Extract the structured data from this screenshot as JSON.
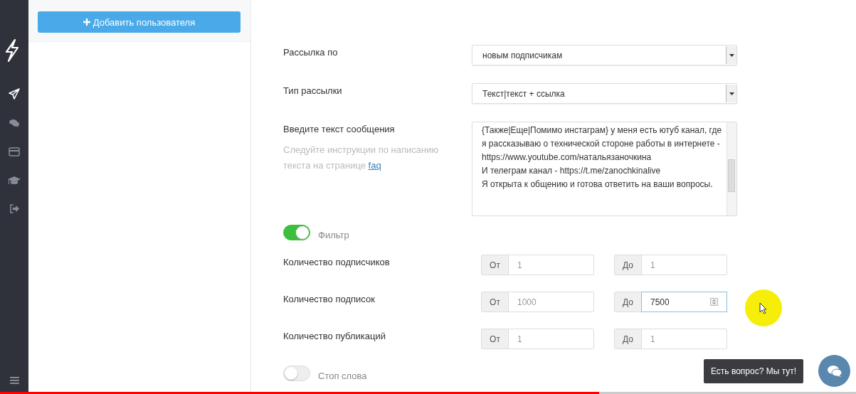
{
  "side_panel": {
    "add_button": "Добавить пользователя"
  },
  "form": {
    "selects": [
      {
        "label": "Рассылка по",
        "value": "новым подписчикам"
      },
      {
        "label": "Тип рассылки",
        "value": "Текст|текст + ссылка"
      }
    ],
    "message": {
      "label": "Введите текст сообщения",
      "hint": "Следуйте инструкции по написанию текста на странице",
      "hint_link": "faq",
      "value": "{Также|Еще|Помимо инстаграм} у меня есть ютуб канал, где я рассказываю о технической стороне работы в интернете - https://www.youtube.com/натальязаночкина\nИ телеграм канал - https://t.me/zanochkinalive\nЯ открыта к общению и готова ответить на ваши вопросы."
    },
    "filter": {
      "label": "Фильтр",
      "on": true
    },
    "ranges": [
      {
        "label": "Количество подписчиков",
        "from_label": "От",
        "from": "1",
        "to_label": "До",
        "to": "1",
        "focused": false
      },
      {
        "label": "Количество подписок",
        "from_label": "От",
        "from": "1000",
        "to_label": "До",
        "to": "7500",
        "focused": true
      },
      {
        "label": "Количество публикаций",
        "from_label": "От",
        "from": "1",
        "to_label": "До",
        "to": "1",
        "focused": false
      }
    ],
    "stop_words": {
      "label": "Стоп слова",
      "on": false
    }
  },
  "chat": {
    "tooltip": "Есть вопрос? Мы тут!"
  },
  "video_progress": {
    "level": 0.7
  }
}
